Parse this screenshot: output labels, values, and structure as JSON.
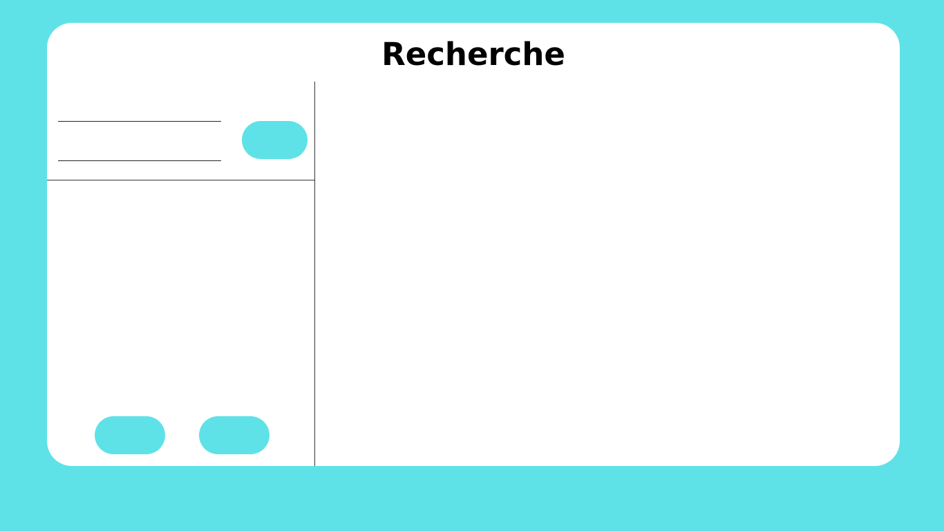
{
  "header": {
    "title": "Recherche"
  },
  "search": {
    "field_1_value": "",
    "field_2_value": "",
    "search_button_label": ""
  },
  "footer": {
    "left_button_label": "",
    "right_button_label": ""
  },
  "colors": {
    "background": "#5ee2e7",
    "card": "#ffffff",
    "accent": "#5ee2e7",
    "divider": "#333333"
  }
}
